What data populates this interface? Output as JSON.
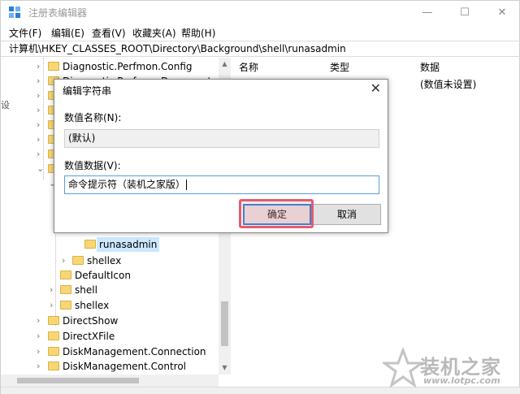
{
  "window": {
    "title": "注册表编辑器",
    "controls": {
      "minimize": "—",
      "maximize": "☐",
      "close": "✕"
    }
  },
  "menu": [
    "文件(F)",
    "编辑(E)",
    "查看(V)",
    "收藏夹(A)",
    "帮助(H)"
  ],
  "address": "计算机\\HKEY_CLASSES_ROOT\\Directory\\Background\\shell\\runasadmin",
  "tree": {
    "items": [
      {
        "label": "Diagnostic.Perfmon.Config",
        "chevron": "›"
      },
      {
        "label": "Diagnostic.Perfmon.Document",
        "chevron": "›"
      },
      {
        "label": "runasadmin",
        "chevron": ""
      },
      {
        "label": "shellex",
        "chevron": "›"
      },
      {
        "label": "DefaultIcon",
        "chevron": ""
      },
      {
        "label": "shell",
        "chevron": "›"
      },
      {
        "label": "shellex",
        "chevron": "›"
      },
      {
        "label": "DirectShow",
        "chevron": "›"
      },
      {
        "label": "DirectXFile",
        "chevron": "›"
      },
      {
        "label": "DiskManagement.Connection",
        "chevron": "›"
      },
      {
        "label": "DiskManagement.Control",
        "chevron": "›"
      }
    ],
    "expanded_chevrons": [
      "⌄",
      "⌄"
    ]
  },
  "list": {
    "columns": [
      "名称",
      "类型",
      "数据"
    ],
    "rows": [
      {
        "data": "(数值未设置)"
      }
    ]
  },
  "dialog": {
    "title": "编辑字符串",
    "close": "✕",
    "name_label": "数值名称(N):",
    "name_value": "(默认)",
    "data_label": "数值数据(V):",
    "data_value": "命令提示符（装机之家版）",
    "ok_label": "确定",
    "cancel_label": "取消"
  },
  "watermark": {
    "text": "装机之家",
    "url": "www.lotpc.com"
  },
  "colors": {
    "highlight": "#e35c6e",
    "accent": "#0078d7",
    "folder": "#f7d774"
  }
}
